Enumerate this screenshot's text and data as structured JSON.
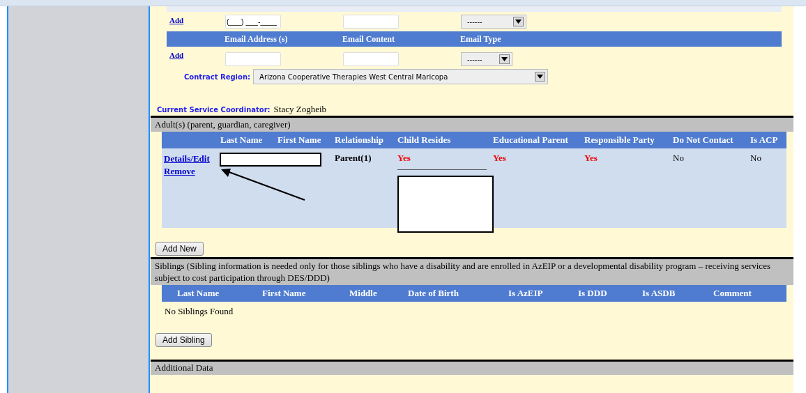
{
  "phone_row": {
    "link": "Add",
    "phone_value": "(___) ___-____",
    "select_value": "------"
  },
  "email": {
    "columns": [
      "Email Address (s)",
      "Email Content",
      "Email Type"
    ],
    "link": "Add",
    "select_value": "------"
  },
  "contract_region": {
    "label": "Contract Region:",
    "value": "Arizona Cooperative Therapies West Central Maricopa"
  },
  "coordinator": {
    "label": "Current Service Coordinator:",
    "value": "Stacy Zogheib"
  },
  "adults": {
    "title": "Adult(s) (parent, guardian, caregiver)",
    "columns": [
      "Last Name",
      "First Name",
      "Relationship",
      "Child Resides",
      "Educational Parent",
      "Responsible Party",
      "Do Not Contact",
      "Is ACP"
    ],
    "rows": [
      {
        "links": [
          "Details/Edit",
          "Remove"
        ],
        "relationship": "Parent(1)",
        "child_resides": "Yes",
        "educational_parent": "Yes",
        "responsible_party": "Yes",
        "do_not_contact": "No",
        "is_acp": "No"
      }
    ],
    "button": "Add New"
  },
  "siblings": {
    "title": "Siblings (Sibling information is needed only for those siblings who have a disability and are enrolled in AzEIP or a developmental disability program – receiving services subject to cost participation through DES/DDD)",
    "columns": [
      "Last Name",
      "First Name",
      "Middle",
      "Date of Birth",
      "Is AzEIP",
      "Is DDD",
      "Is ASDB",
      "Comment"
    ],
    "empty": "No Siblings Found",
    "button": "Add Sibling"
  },
  "additional": {
    "title": "Additional Data"
  }
}
